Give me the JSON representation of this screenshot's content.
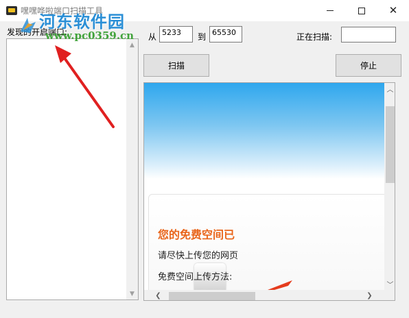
{
  "window": {
    "title": "嘿嘿哗啦端口扫描工具",
    "minimize_glyph": "",
    "close_glyph": "✕"
  },
  "watermark": {
    "logo_text": "河东软件园",
    "url_text": "www.pc0359.cn"
  },
  "ports_panel": {
    "label": "发现的开启端口:"
  },
  "range": {
    "from_label": "从",
    "from_value": "5233",
    "to_label": "到",
    "to_value": "65530"
  },
  "scanning": {
    "label": "正在扫描:",
    "value": ""
  },
  "buttons": {
    "scan_label": "扫描",
    "stop_label": "停止"
  },
  "browser": {
    "card_title": "您的免费空间已",
    "card_line1": "请尽快上传您的网页",
    "card_line2": "免费空间上传方法:"
  },
  "colors": {
    "accent_orange": "#e9651a",
    "watermark_blue": "#2b8fd6",
    "watermark_green": "#41a33b",
    "arrow_red": "#e02020"
  }
}
